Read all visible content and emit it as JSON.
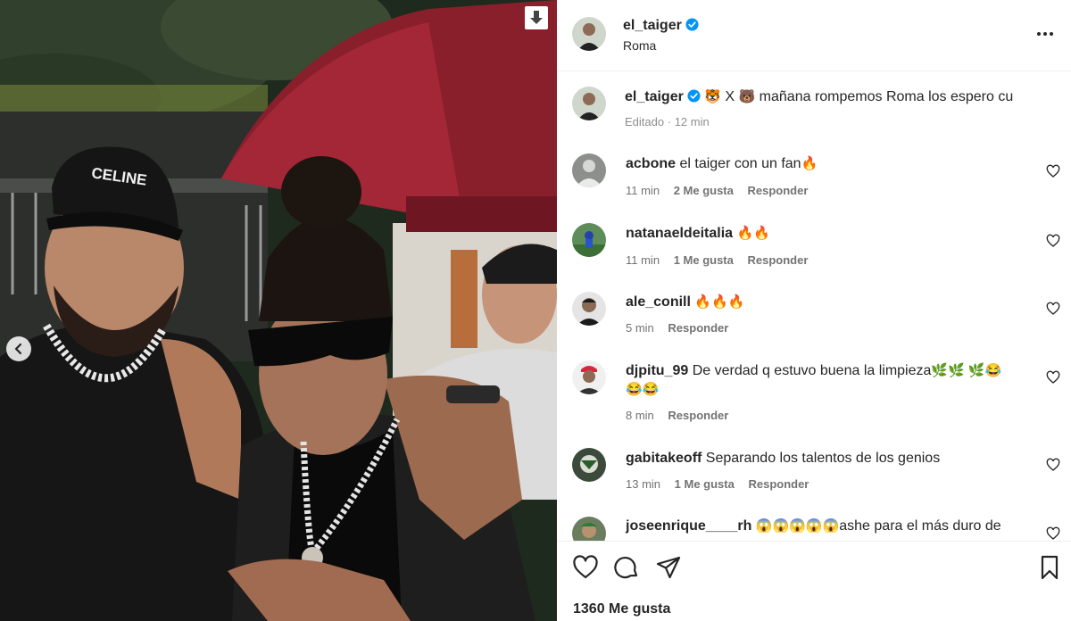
{
  "post": {
    "author": "el_taiger",
    "location": "Roma"
  },
  "caption": {
    "author": "el_taiger",
    "emoji_a": "🐯",
    "x_text": "X",
    "emoji_b": "🐻",
    "text": "mañana rompemos Roma los espero cu",
    "edited": "Editado",
    "sep": "·",
    "time": "12 min"
  },
  "comments": [
    {
      "user": "acbone",
      "text": "el taiger con un fan",
      "emojis": "🔥",
      "time": "11 min",
      "likes": "2 Me gusta",
      "reply": "Responder"
    },
    {
      "user": "natanaeldeitalia",
      "text": "",
      "emojis": "🔥🔥",
      "time": "11 min",
      "likes": "1 Me gusta",
      "reply": "Responder"
    },
    {
      "user": "ale_conill",
      "text": "",
      "emojis": "🔥🔥🔥",
      "time": "5 min",
      "likes": "",
      "reply": "Responder"
    },
    {
      "user": "djpitu_99",
      "text": "De verdad q estuvo buena la limpieza",
      "emojis": "🌿🌿 🌿😂",
      "emojis2": "😂😂",
      "time": "8 min",
      "likes": "",
      "reply": "Responder"
    },
    {
      "user": "gabitakeoff",
      "text": "Separando los talentos de los genios",
      "emojis": "",
      "time": "13 min",
      "likes": "1 Me gusta",
      "reply": "Responder"
    },
    {
      "user": "joseenrique____rh",
      "text": "ashe para el más duro de",
      "emojis": "😱😱😱😱😱",
      "time": "",
      "likes": "",
      "reply": ""
    }
  ],
  "footer": {
    "likes": "1360 Me gusta"
  },
  "icons": {
    "download": "download-icon",
    "prev": "chevron-left-icon",
    "verified": "verified-badge-icon",
    "more": "more-options-icon",
    "like": "heart-icon",
    "comment": "comment-icon",
    "share": "share-icon",
    "save": "bookmark-icon"
  },
  "colors": {
    "verified": "#0095f6",
    "text": "#262626",
    "muted": "#737373",
    "border": "#efefef"
  }
}
